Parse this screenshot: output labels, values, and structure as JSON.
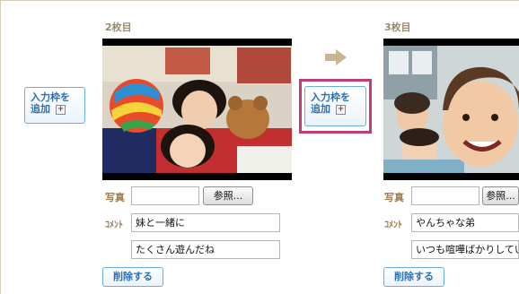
{
  "left_add_button": {
    "line1": "入力枠を",
    "line2": "追加",
    "plus": "+"
  },
  "middle_add_button": {
    "line1": "入力枠を",
    "line2": "追加",
    "plus": "+"
  },
  "columns": [
    {
      "title": "2枚目",
      "photo_label": "写真",
      "browse_label": "参照...",
      "comment_label": "ｺﾒﾝﾄ",
      "comment_line1": "妹と一緒に",
      "comment_line2": "たくさん遊んだね",
      "delete_label": "削除する"
    },
    {
      "title": "3枚目",
      "photo_label": "写真",
      "browse_label": "参照...",
      "comment_label": "ｺﾒﾝﾄ",
      "comment_line1": "やんちゃな弟",
      "comment_line2": "いつも喧嘩ばかりしてい",
      "delete_label": "削除する"
    }
  ],
  "colors": {
    "highlight": "#c23b74",
    "accent_blue": "#2a6fb4",
    "label_brown": "#9a7c50"
  }
}
